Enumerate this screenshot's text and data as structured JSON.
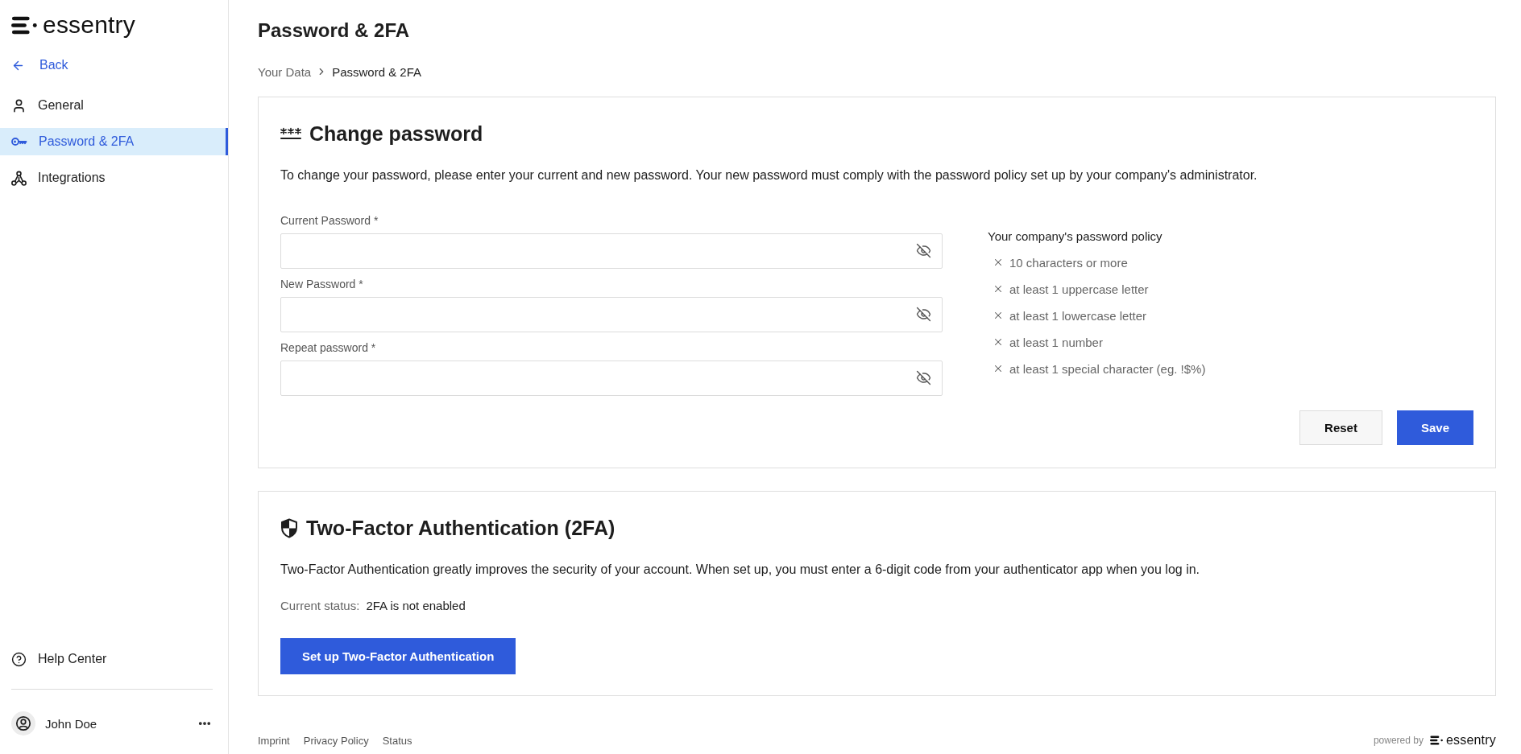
{
  "sidebar": {
    "logo": "essentry",
    "back": "Back",
    "items": [
      {
        "kind": "person",
        "label": "General",
        "selected": false
      },
      {
        "kind": "key",
        "label": "Password & 2FA",
        "selected": true
      },
      {
        "kind": "network",
        "label": "Integrations",
        "selected": false
      }
    ],
    "help": "Help Center",
    "user": {
      "name": "John Doe"
    }
  },
  "page": {
    "title": "Password & 2FA",
    "breadcrumb": [
      {
        "label": "Your Data",
        "current": false
      },
      {
        "label": "Password & 2FA",
        "current": true
      }
    ]
  },
  "change_password": {
    "title": "Change password",
    "description": "To change your password, please enter your current and new password. Your new password must comply with the password policy set up by your company's administrator.",
    "fields": [
      {
        "label": "Current Password *",
        "visible": false
      },
      {
        "label": "New Password *",
        "visible": false
      },
      {
        "label": "Repeat password *",
        "visible": false
      }
    ],
    "policy": {
      "title": "Your company's password policy",
      "rules": [
        {
          "text": "10 characters or more",
          "met": false
        },
        {
          "text": "at least 1 uppercase letter",
          "met": false
        },
        {
          "text": "at least 1 lowercase letter",
          "met": false
        },
        {
          "text": "at least 1 number",
          "met": false
        },
        {
          "text": "at least 1 special character (eg. !$%)",
          "met": false
        }
      ]
    },
    "buttons": [
      {
        "kind": "secondary",
        "label": "Reset"
      },
      {
        "kind": "primary",
        "label": "Save"
      }
    ]
  },
  "two_factor": {
    "title": "Two-Factor Authentication (2FA)",
    "description": "Two-Factor Authentication greatly improves the security of your account. When set up, you must enter a 6-digit code from your authenticator app when you log in.",
    "status_label": "Current status:",
    "status": "2FA is not enabled",
    "button": "Set up Two-Factor Authentication"
  },
  "footer": {
    "links": [
      "Imprint",
      "Privacy Policy",
      "Status"
    ],
    "powered_by": "powered by",
    "logo": "essentry"
  }
}
